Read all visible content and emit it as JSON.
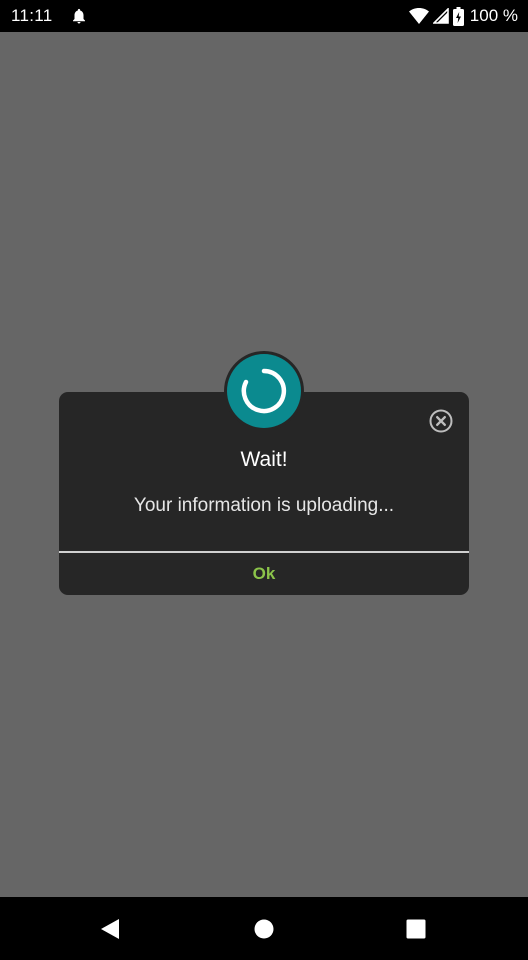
{
  "status_bar": {
    "time": "11:11",
    "battery_percent": "100 %",
    "icons": [
      "notification-bell-icon",
      "wifi-icon",
      "cellular-signal-icon",
      "battery-charging-icon"
    ]
  },
  "dialog": {
    "title": "Wait!",
    "message": "Your information is uploading...",
    "ok_label": "Ok",
    "accent_color": "#8bc34a",
    "spinner_color": "#0b8a8f",
    "icons": [
      "loading-spinner-icon",
      "close-icon"
    ]
  },
  "nav_bar": {
    "icons": [
      "back-icon",
      "home-icon",
      "recents-icon"
    ]
  }
}
